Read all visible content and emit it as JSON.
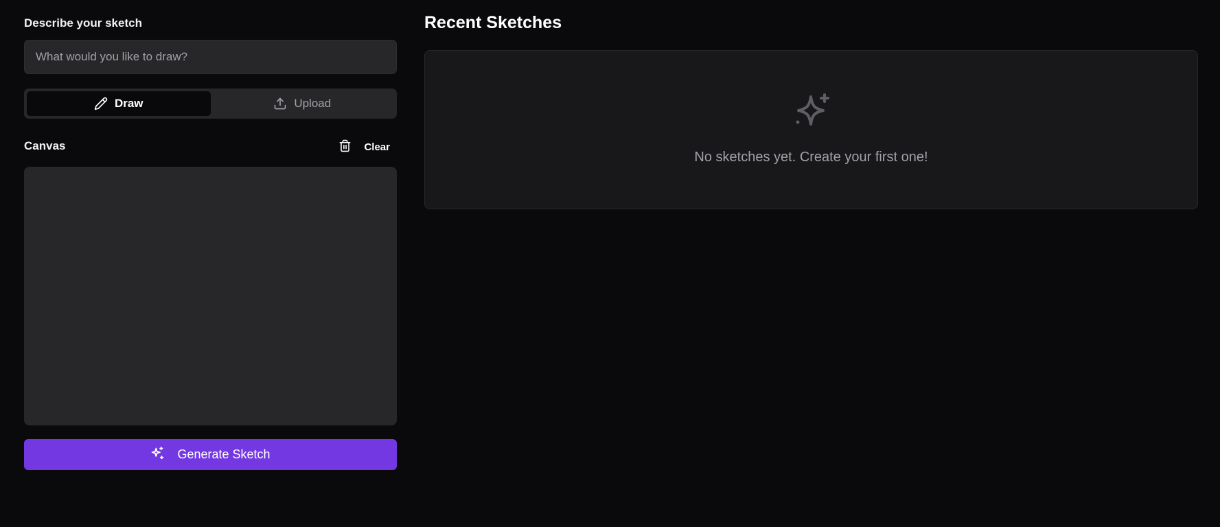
{
  "compose": {
    "describe_label": "Describe your sketch",
    "prompt_placeholder": "What would you like to draw?",
    "prompt_value": "",
    "modes": [
      {
        "label": "Draw",
        "icon": "pencil-icon",
        "active": true
      },
      {
        "label": "Upload",
        "icon": "upload-icon",
        "active": false
      }
    ],
    "canvas_label": "Canvas",
    "clear_label": "Clear",
    "generate_label": "Generate Sketch"
  },
  "recent": {
    "title": "Recent Sketches",
    "empty_message": "No sketches yet. Create your first one!",
    "empty_icon": "sparkles-icon"
  },
  "colors": {
    "background": "#0a0a0c",
    "surface": "#27272a",
    "card": "#18181b",
    "accent": "#7438e3",
    "muted_text": "#a1a1aa"
  }
}
